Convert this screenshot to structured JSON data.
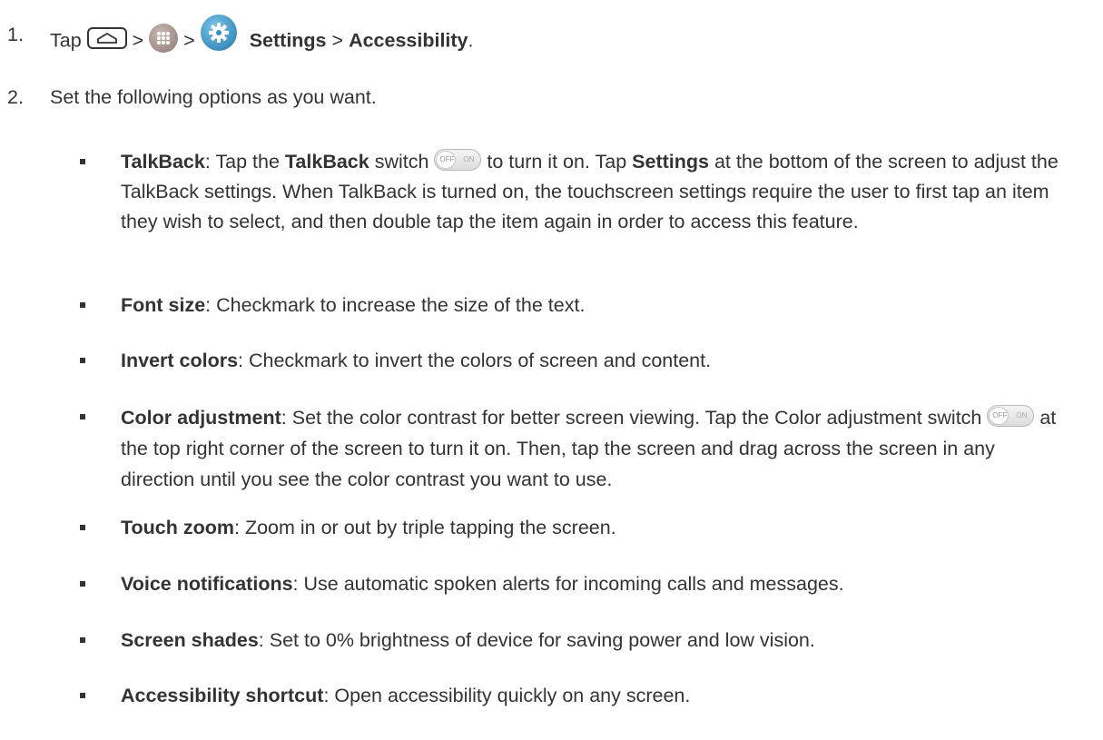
{
  "steps": [
    {
      "number": "1.",
      "tap": "Tap",
      "sep1": ">",
      "sep2": ">",
      "settings": "Settings",
      "sep3": ">",
      "accessibility": "Accessibility",
      "end": "."
    },
    {
      "number": "2.",
      "text": "Set the following options as you want."
    }
  ],
  "toggle": {
    "off": "OFF",
    "on": "ON"
  },
  "bullets": {
    "talkback": {
      "term": "TalkBack",
      "t1": ": Tap the ",
      "bold2": "TalkBack",
      "t2": " switch ",
      "t3": " to turn it on. Tap ",
      "bold3": "Settings",
      "t4": " at the bottom of the screen to adjust the TalkBack settings. When TalkBack is turned on, the touchscreen settings require the user to first tap an item they wish to select, and then double tap the item again in order to access this feature."
    },
    "font_size": {
      "term": "Font size",
      "text": ": Checkmark to increase the size of the text."
    },
    "invert_colors": {
      "term": "Invert colors",
      "text": ": Checkmark to invert the colors of screen and content."
    },
    "color_adjustment": {
      "term": "Color adjustment",
      "t1": ": Set the color contrast for better screen viewing. Tap the Color adjustment switch ",
      "t2": " at the top right corner of the screen to turn it on. Then, tap the screen and drag across the screen in any direction until you see the color contrast you want to use."
    },
    "touch_zoom": {
      "term": "Touch zoom",
      "text": ": Zoom in or out by triple tapping the screen."
    },
    "voice_notifications": {
      "term": "Voice notifications",
      "text": ": Use automatic spoken alerts for incoming calls and messages."
    },
    "screen_shades": {
      "term": "Screen shades",
      "text": ": Set to 0% brightness of device for saving power and low vision."
    },
    "accessibility_shortcut": {
      "term": "Accessibility shortcut",
      "text": ": Open accessibility quickly on any screen."
    }
  },
  "icons": [
    "home-icon",
    "apps-icon",
    "settings-gear-icon",
    "toggle-switch-icon"
  ],
  "colors": {
    "text": "#333333",
    "settings_icon": "#3a8fc0",
    "apps_icon": "#9e8b86"
  }
}
